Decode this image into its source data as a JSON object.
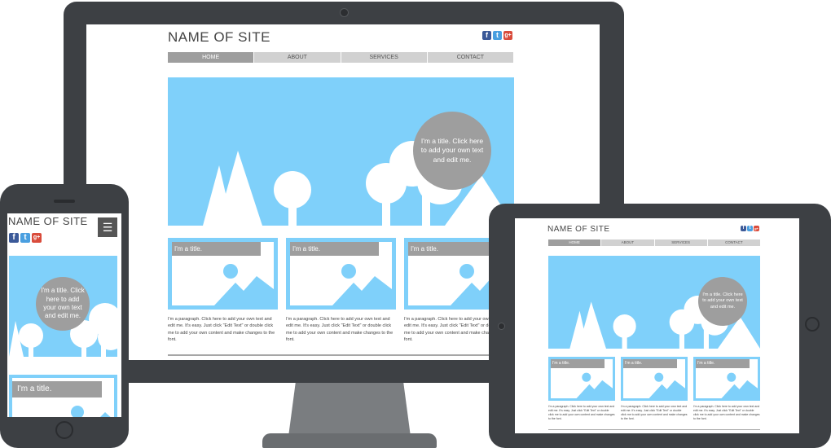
{
  "site": {
    "name": "NAME OF SITE",
    "nav": [
      "HOME",
      "ABOUT",
      "SERVICES",
      "CONTACT"
    ],
    "hero_text": "I'm a title. Click here to add your own text and edit me.",
    "card_title": "I'm a title.",
    "paragraph": "I'm a paragraph. Click here to add your own text and edit me. It's easy. Just click \"Edit Text\" or double click me to add your own content and make changes to the font.",
    "social": {
      "facebook": "f",
      "twitter": "t",
      "google": "g+"
    }
  },
  "mobile": {
    "menu_icon": "☰"
  },
  "colors": {
    "device": "#3d4044",
    "hero_sky": "#7fd0fa",
    "accent_gray": "#9e9e9e",
    "nav_bg": "#d1d1d1"
  }
}
